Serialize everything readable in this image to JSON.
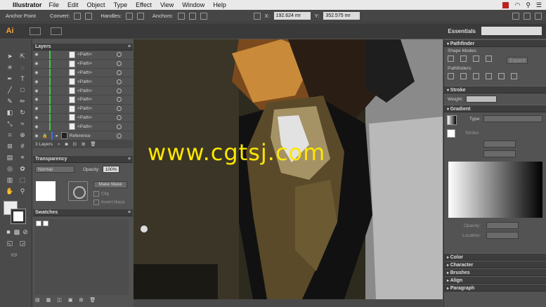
{
  "menubar": {
    "app": "Illustrator",
    "items": [
      "File",
      "Edit",
      "Object",
      "Type",
      "Effect",
      "View",
      "Window",
      "Help"
    ]
  },
  "controlbar": {
    "tool": "Anchor Point",
    "convert": "Convert:",
    "handles": "Handles:",
    "anchors": "Anchors:",
    "x_label": "X:",
    "x_value": "192.624 mr",
    "y_label": "Y:",
    "y_value": "352.575 mr"
  },
  "appbar": {
    "logo": "Ai",
    "workspace": "Essentials"
  },
  "layers": {
    "title": "Layers",
    "rows": [
      "<Path>",
      "<Path>",
      "<Path>",
      "<Path>",
      "<Path>",
      "<Path>",
      "<Path>",
      "<Path>",
      "<Path>"
    ],
    "reference": "Reference",
    "count": "3 Layers"
  },
  "transparency": {
    "title": "Transparency",
    "blend_mode": "Normal",
    "opacity_label": "Opacity:",
    "opacity_value": "100%",
    "make_mask": "Make Mask",
    "clip": "Clip",
    "invert_mask": "Invert Mask"
  },
  "swatches": {
    "title": "Swatches"
  },
  "canvas": {
    "watermark": "www.cgtsj.com"
  },
  "pathfinder": {
    "title": "Pathfinder",
    "shape_modes": "Shape Modes:",
    "expand": "Expand",
    "pathfinders": "Pathfinders:"
  },
  "stroke": {
    "title": "Stroke",
    "weight_label": "Weight:"
  },
  "gradient": {
    "title": "Gradient",
    "type_label": "Type:",
    "stroke_label": "Stroke:",
    "opacity_label": "Opacity:",
    "location_label": "Location:"
  },
  "collapsed_panels": [
    "Color",
    "Character",
    "Brushes",
    "Align",
    "Paragraph"
  ]
}
